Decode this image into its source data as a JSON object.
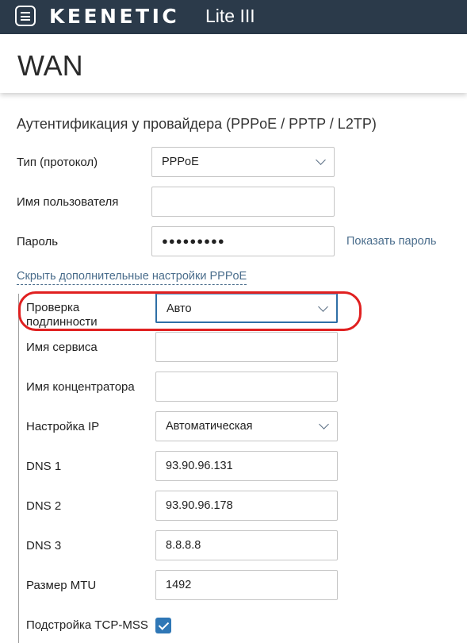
{
  "topbar": {
    "brand": "KEENETIC",
    "model": "Lite III"
  },
  "page": {
    "title": "WAN"
  },
  "auth": {
    "section_title": "Аутентификация у провайдера (PPPoE / PPTP / L2TP)",
    "type_label": "Тип (протокол)",
    "type_value": "PPPoE",
    "username_label": "Имя пользователя",
    "username_value": "",
    "password_label": "Пароль",
    "password_value": "●●●●●●●●●",
    "show_password": "Показать пароль",
    "toggle_advanced": "Скрыть дополнительные настройки PPPoE"
  },
  "advanced": {
    "auth_check_label": "Проверка подлинности",
    "auth_check_value": "Авто",
    "service_label": "Имя сервиса",
    "service_value": "",
    "concentrator_label": "Имя концентратора",
    "concentrator_value": "",
    "ip_label": "Настройка IP",
    "ip_value": "Автоматическая",
    "dns1_label": "DNS 1",
    "dns1_value": "93.90.96.131",
    "dns2_label": "DNS 2",
    "dns2_value": "93.90.96.178",
    "dns3_label": "DNS 3",
    "dns3_value": "8.8.8.8",
    "mtu_label": "Размер MTU",
    "mtu_value": "1492",
    "tcpmss_label": "Подстройка TCP-MSS",
    "tcpmss_checked": true
  },
  "icons": {
    "menu": "menu-icon",
    "dropdown": "chevron-down-icon",
    "check": "check-icon"
  },
  "colors": {
    "topbar": "#2b3a4a",
    "link": "#4a6d8c",
    "checkbox": "#2f77b6",
    "highlight": "#e02020"
  }
}
